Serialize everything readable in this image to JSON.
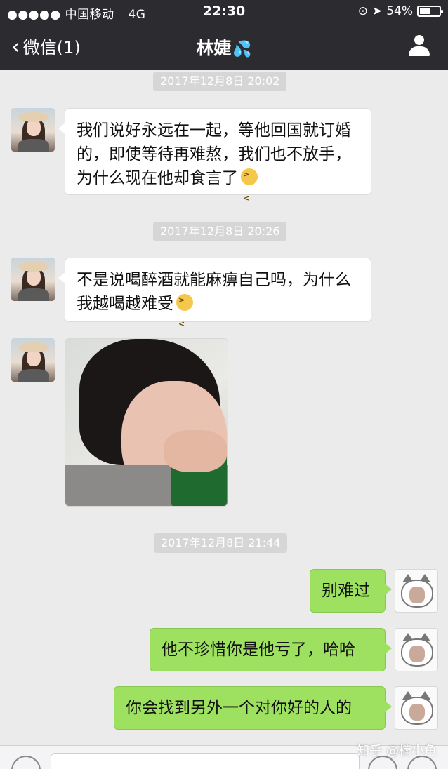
{
  "status_bar": {
    "carrier": "●●●●● 中国移动",
    "network": "4G",
    "time": "22:30",
    "battery": "54%",
    "battery_level": 0.54
  },
  "nav": {
    "back_label": "微信(1)",
    "title": "林婕",
    "title_emoji": "💦"
  },
  "messages": [
    {
      "timestamp": "2017年12月8日 20:02"
    },
    {
      "from": "them",
      "text": "我们说好永远在一起，等他回国就订婚的，即使等待再难熬，我们也不放手，为什么现在他却食言了"
    },
    {
      "timestamp": "2017年12月8日 20:26"
    },
    {
      "from": "them",
      "text": "不是说喝醉酒就能麻痹自己吗，为什么我越喝越难受"
    },
    {
      "from": "them",
      "image": "crying-girl-photo"
    },
    {
      "timestamp": "2017年12月8日 21:44"
    },
    {
      "from": "me",
      "text": "别难过"
    },
    {
      "from": "me",
      "text": "他不珍惜你是他亏了，哈哈"
    },
    {
      "from": "me",
      "text": "你会找到另外一个对你好的人的"
    }
  ],
  "watermark": "知乎 @楠小鱼",
  "colors": {
    "header": "#2c2c30",
    "chat_bg": "#ebebeb",
    "outgoing_bubble": "#9ee060",
    "incoming_bubble": "#ffffff",
    "timestamp_bg": "#d6d6d6"
  }
}
